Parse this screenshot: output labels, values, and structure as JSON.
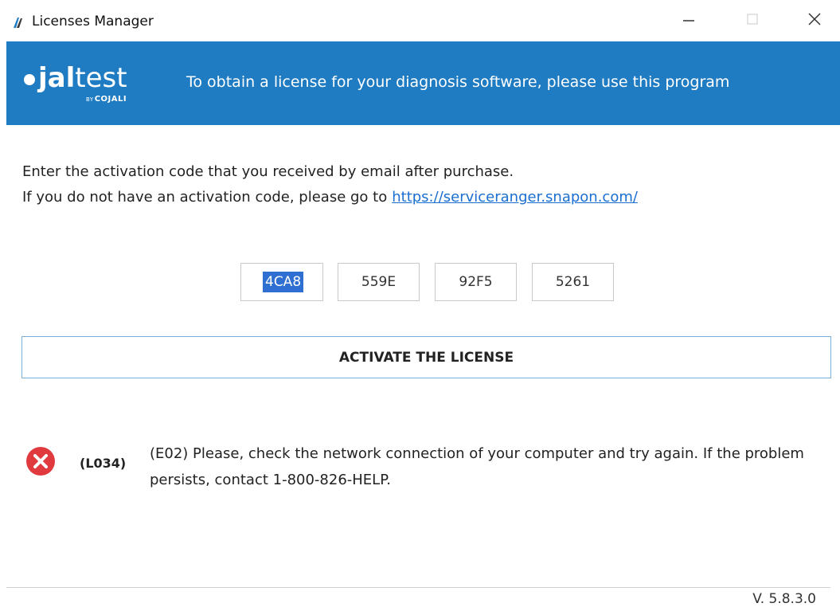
{
  "window": {
    "title": "Licenses Manager",
    "minimize_icon": "minimize-icon",
    "maximize_icon": "maximize-icon",
    "close_icon": "close-icon"
  },
  "banner": {
    "logo": {
      "brand_bold": "jal",
      "brand_light": "test",
      "sub_by": "BY",
      "sub_brand": "COJALI"
    },
    "tagline": "To obtain a license for your diagnosis software, please use this program",
    "background_color": "#1f7bc2"
  },
  "instructions": {
    "line1": "Enter the activation code that you received by email after purchase.",
    "line2": "If you do not have an activation code, please go to",
    "link_text": "https://serviceranger.snapon.com/"
  },
  "activation_code": {
    "fields": [
      "4CA8",
      "559E",
      "92F5",
      "5261"
    ]
  },
  "activate_button": {
    "label": "ACTIVATE THE LICENSE"
  },
  "error": {
    "icon": "error-icon",
    "code": "(L034)",
    "message": "(E02) Please, check the network connection of your computer and try again. If the problem persists, contact 1-800-826-HELP.",
    "color": "#e03a3e"
  },
  "footer": {
    "version": "V. 5.8.3.0"
  }
}
